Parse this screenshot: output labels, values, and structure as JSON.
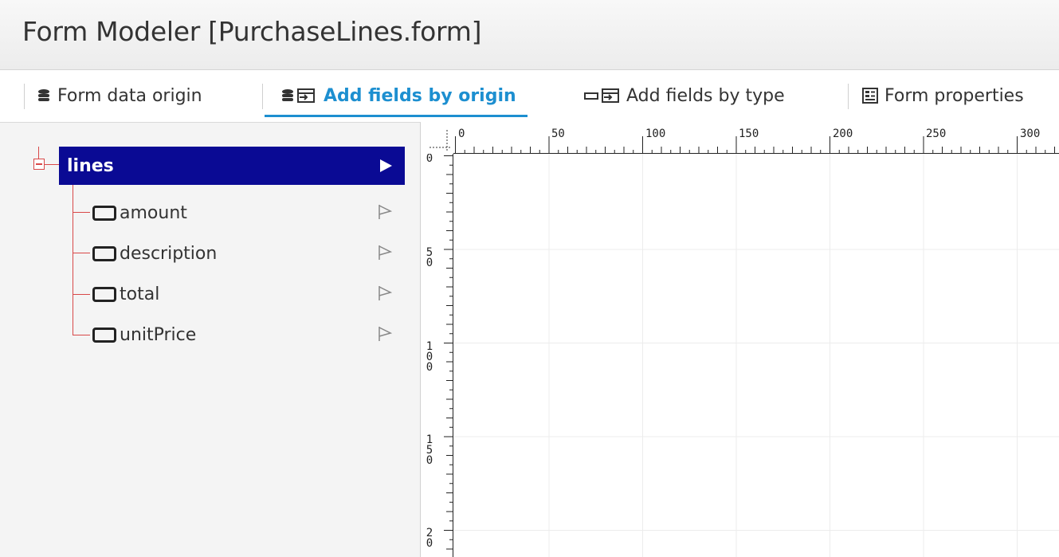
{
  "window": {
    "title": "Form Modeler [PurchaseLines.form]"
  },
  "tabs": [
    {
      "label": "Form data origin",
      "icon": "database-icon",
      "active": false
    },
    {
      "label": "Add fields by origin",
      "icon": "database-add-icon",
      "active": true
    },
    {
      "label": "Add fields by type",
      "icon": "field-add-icon",
      "active": false
    },
    {
      "label": "Form properties",
      "icon": "form-properties-icon",
      "active": false
    }
  ],
  "tree": {
    "root": {
      "label": "lines",
      "expanded": true
    },
    "items": [
      {
        "label": "amount"
      },
      {
        "label": "description"
      },
      {
        "label": "total"
      },
      {
        "label": "unitPrice"
      }
    ]
  },
  "ruler": {
    "horizontal_labels": [
      "0",
      "50",
      "100",
      "150",
      "200",
      "250",
      "300"
    ],
    "vertical_labels": [
      "0",
      "50",
      "100",
      "150",
      "20"
    ]
  },
  "colors": {
    "accent": "#1d8fd0",
    "tree_selected": "#0a0a94",
    "tree_lines": "#d84848"
  }
}
